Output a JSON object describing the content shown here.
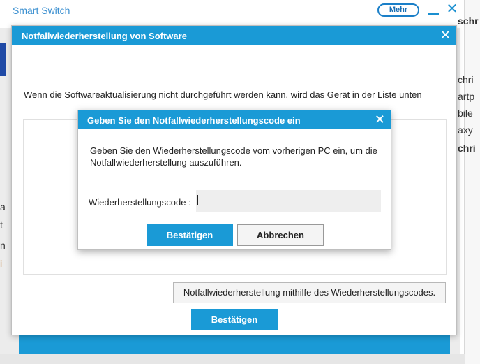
{
  "app": {
    "title": "Smart Switch",
    "more_label": "Mehr",
    "minimize_glyph": "_",
    "close_glyph": "✕"
  },
  "background": {
    "left_fragments": [
      "a",
      "t",
      "n",
      "i"
    ],
    "right_fragments": [
      "schr",
      "chri",
      "artp",
      "bile",
      "axy",
      "chri"
    ]
  },
  "dialog_software": {
    "title": "Notfallwiederherstellung von Software",
    "close_glyph": "✕",
    "message": "Wenn die Softwareaktualisierung nicht durchgeführt werden kann, wird das Gerät in der Liste unten",
    "code_button_label": "Notfallwiederherstellung mithilfe des Wiederherstellungscodes.",
    "confirm_label": "Bestätigen"
  },
  "dialog_code": {
    "title": "Geben Sie den Notfallwiederherstellungscode ein",
    "close_glyph": "✕",
    "description": "Geben Sie den Wiederherstellungscode vom vorherigen PC ein, um die Notfallwiederherstellung auszuführen.",
    "field_label": "Wiederherstellungscode :",
    "field_value": "",
    "confirm_label": "Bestätigen",
    "cancel_label": "Abbrechen"
  },
  "colors": {
    "accent": "#1a9ad6",
    "title_text": "#3a8fd0",
    "sidebar_blue": "#1f4aa6"
  }
}
